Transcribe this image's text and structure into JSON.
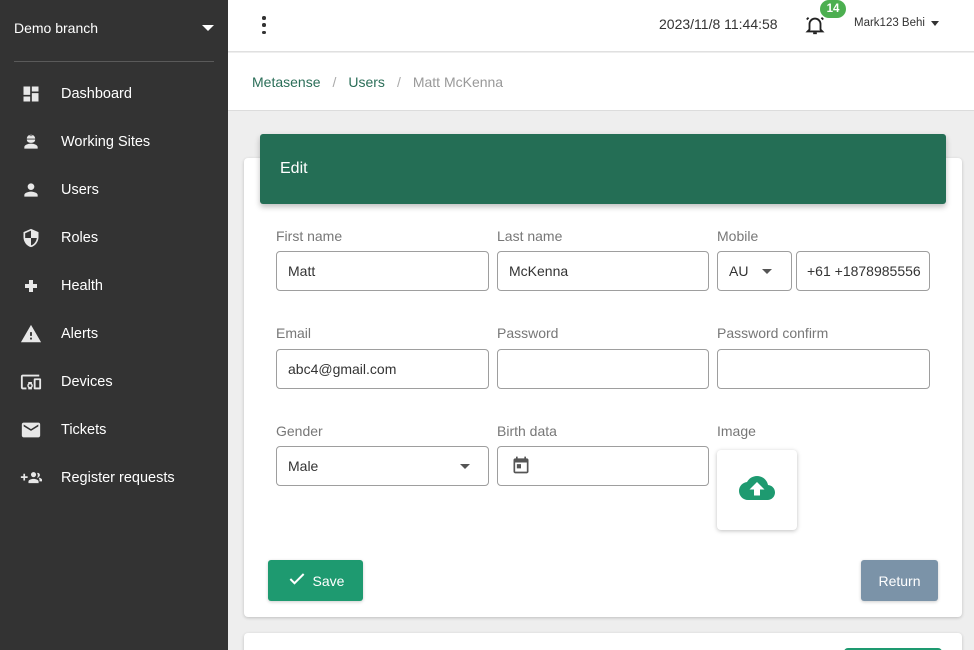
{
  "sidebar": {
    "branch": "Demo branch",
    "items": [
      {
        "label": "Dashboard",
        "icon": "dashboard-icon"
      },
      {
        "label": "Working Sites",
        "icon": "worker-icon"
      },
      {
        "label": "Users",
        "icon": "person-icon"
      },
      {
        "label": "Roles",
        "icon": "shield-icon"
      },
      {
        "label": "Health",
        "icon": "plus-icon"
      },
      {
        "label": "Alerts",
        "icon": "warning-icon"
      },
      {
        "label": "Devices",
        "icon": "devices-icon"
      },
      {
        "label": "Tickets",
        "icon": "mail-icon"
      },
      {
        "label": "Register requests",
        "icon": "group-add-icon"
      }
    ]
  },
  "topbar": {
    "datetime": "2023/11/8 11:44:58",
    "notification_count": "14",
    "user_name": "Mark123 Behi"
  },
  "breadcrumb": {
    "root": "Metasense",
    "section": "Users",
    "current": "Matt McKenna"
  },
  "form": {
    "title": "Edit",
    "first_name_label": "First name",
    "first_name_value": "Matt",
    "last_name_label": "Last name",
    "last_name_value": "McKenna",
    "mobile_label": "Mobile",
    "mobile_country": "AU",
    "mobile_value": "+61 +1878985556",
    "email_label": "Email",
    "email_value": "abc4@gmail.com",
    "password_label": "Password",
    "password_confirm_label": "Password confirm",
    "gender_label": "Gender",
    "gender_value": "Male",
    "birth_label": "Birth data",
    "image_label": "Image",
    "save_label": "Save",
    "return_label": "Return"
  },
  "colors": {
    "sidebar_bg": "#333333",
    "header_green": "#246e55",
    "save_green": "#1e9a70",
    "return_gray": "#7b93a8",
    "badge_green": "#4caf50"
  }
}
